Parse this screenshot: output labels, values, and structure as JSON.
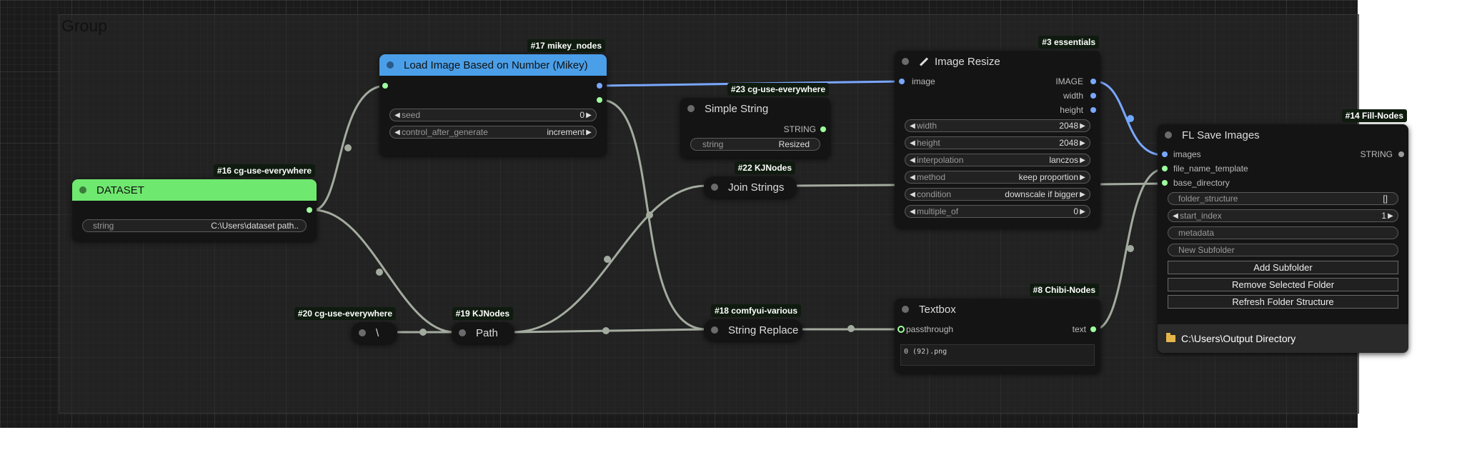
{
  "group": {
    "title": "Group"
  },
  "colors": {
    "canvas": "#1b1b1b",
    "accent_green": "#6ee86e",
    "accent_blue": "#4a9fe8",
    "link_image": "#7aa7ff",
    "link_string": "#a3ab9f"
  },
  "nodes": {
    "dataset": {
      "badge": "#16 cg-use-everywhere",
      "title": "DATASET",
      "widget": {
        "label": "string",
        "value": "C:\\Users\\dataset path.."
      }
    },
    "load_image": {
      "badge": "#17 mikey_nodes",
      "title": "Load Image Based on Number (Mikey)",
      "widgets": [
        {
          "label": "seed",
          "value": "0"
        },
        {
          "label": "control_after_generate",
          "value": "increment"
        }
      ]
    },
    "backslash": {
      "badge": "#20 cg-use-everywhere",
      "title": "\\"
    },
    "path": {
      "badge": "#19 KJNodes",
      "title": "Path"
    },
    "simple_string": {
      "badge": "#23 cg-use-everywhere",
      "title": "Simple String",
      "output": "STRING",
      "widget": {
        "label": "string",
        "value": "Resized"
      }
    },
    "join_strings": {
      "badge": "#22 KJNodes",
      "title": "Join Strings"
    },
    "string_replace": {
      "badge": "#18 comfyui-various",
      "title": "String Replace"
    },
    "image_resize": {
      "badge": "#3 essentials",
      "title": "Image Resize",
      "icon": "pencil-icon",
      "input": "image",
      "outputs": [
        "IMAGE",
        "width",
        "height"
      ],
      "widgets": [
        {
          "label": "width",
          "value": "2048"
        },
        {
          "label": "height",
          "value": "2048"
        },
        {
          "label": "interpolation",
          "value": "lanczos"
        },
        {
          "label": "method",
          "value": "keep proportion"
        },
        {
          "label": "condition",
          "value": "downscale if bigger"
        },
        {
          "label": "multiple_of",
          "value": "0"
        }
      ]
    },
    "textbox": {
      "badge": "#8 Chibi-Nodes",
      "title": "Textbox",
      "input": "passthrough",
      "output": "text",
      "text": "0 (92).png"
    },
    "fl_save": {
      "badge": "#14 Fill-Nodes",
      "title": "FL Save Images",
      "inputs": [
        "images",
        "file_name_template",
        "base_directory"
      ],
      "output": "STRING",
      "widgets": [
        {
          "label": "folder_structure",
          "value": "[]"
        },
        {
          "label": "start_index",
          "value": "1"
        }
      ],
      "text_fields": [
        "metadata",
        "New Subfolder"
      ],
      "buttons": [
        "Add Subfolder",
        "Remove Selected Folder",
        "Refresh Folder Structure"
      ],
      "footer": "C:\\Users\\Output Directory"
    }
  }
}
